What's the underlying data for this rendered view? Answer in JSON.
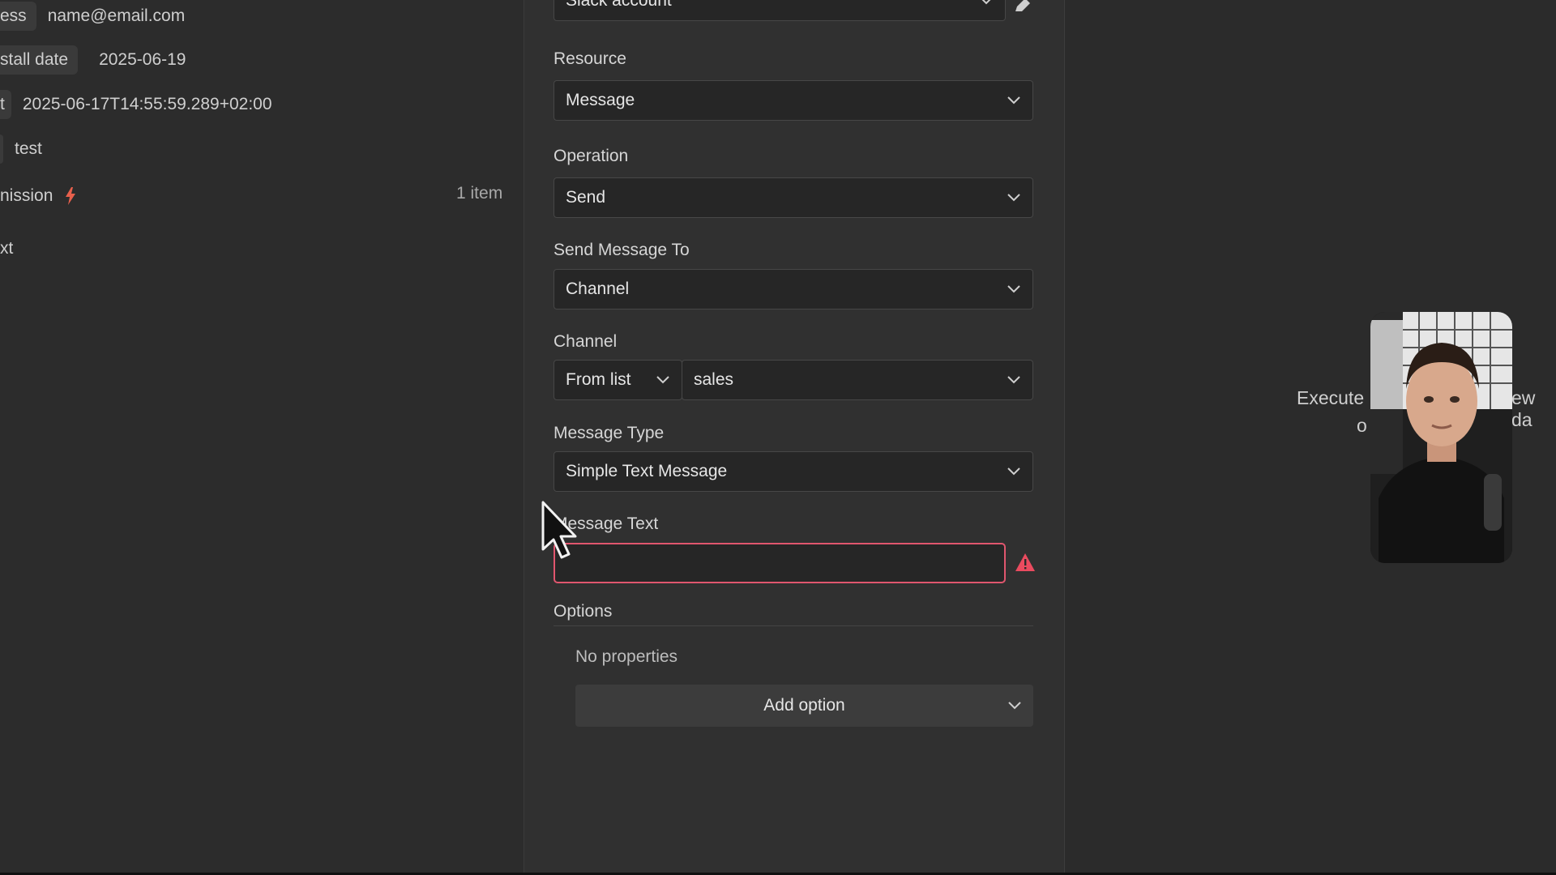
{
  "input_panel": {
    "rows": [
      {
        "key": "ess",
        "value": "name@email.com"
      },
      {
        "key": "stall date",
        "value": "2025-06-19"
      },
      {
        "key": "t",
        "value": "2025-06-17T14:55:59.289+02:00"
      },
      {
        "key": "",
        "value": "test"
      },
      {
        "key": "nission",
        "value": ""
      },
      {
        "key": "xt",
        "value": ""
      }
    ],
    "item_count": "1 item"
  },
  "params": {
    "credential_value": "Slack account",
    "resource": {
      "label": "Resource",
      "value": "Message"
    },
    "operation": {
      "label": "Operation",
      "value": "Send"
    },
    "send_to": {
      "label": "Send Message To",
      "value": "Channel"
    },
    "channel": {
      "label": "Channel",
      "mode": "From list",
      "value": "sales"
    },
    "message_type": {
      "label": "Message Type",
      "value": "Simple Text Message"
    },
    "message_text": {
      "label": "Message Text",
      "value": ""
    },
    "options": {
      "label": "Options",
      "empty_text": "No properties",
      "add_label": "Add option"
    }
  },
  "canvas": {
    "partial_text_left": "Execute",
    "partial_text_below": "o",
    "partial_text_right": "ew da"
  },
  "colors": {
    "error_border": "#e0566e",
    "warning": "#ea4b5f",
    "trigger_icon": "#e8604c"
  }
}
